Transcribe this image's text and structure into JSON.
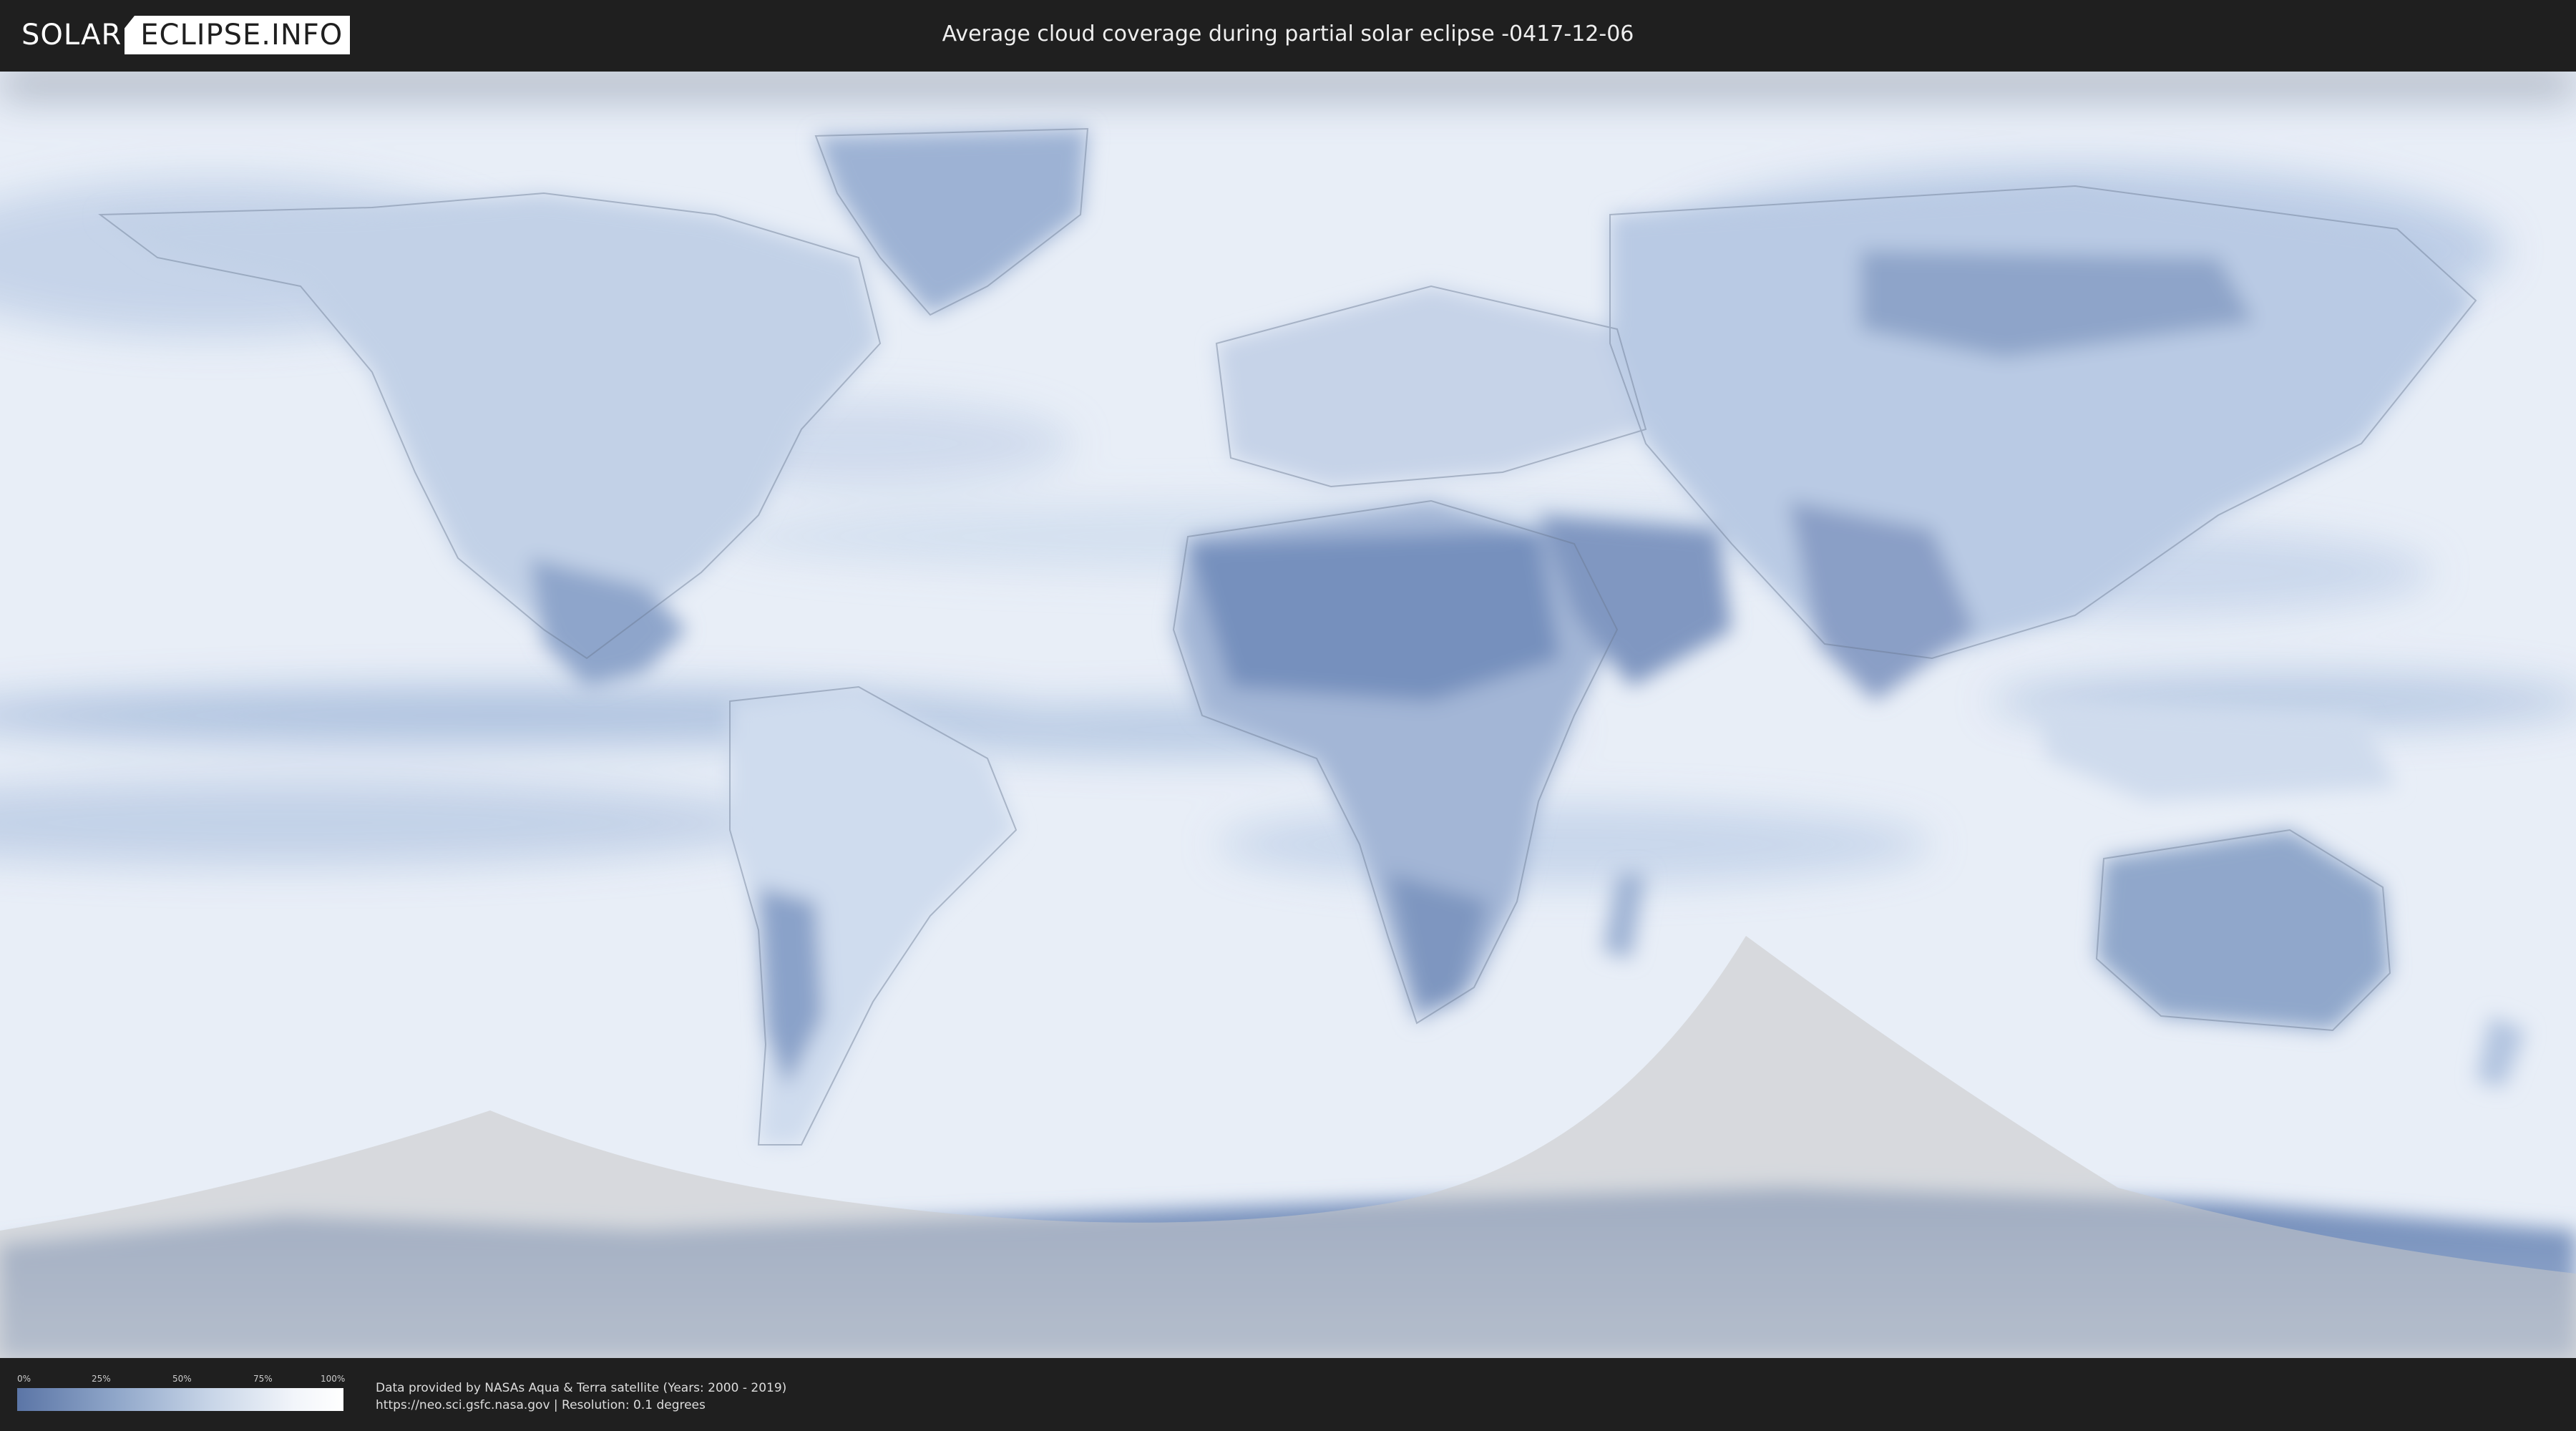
{
  "header": {
    "logo": {
      "part1": "SOLAR",
      "part2": "ECLIPSE.INFO"
    },
    "title": "Average cloud coverage during partial solar eclipse -0417-12-06"
  },
  "map": {
    "description_colors": {
      "ocean_clear": "#ffffff",
      "cloud_low": "#5b75a6",
      "cloud_mid": "#a8bcd9",
      "eclipse_overlay": "#c9c9c9"
    }
  },
  "legend": {
    "ticks": [
      "0%",
      "25%",
      "50%",
      "75%",
      "100%"
    ],
    "gradient_start": "#5b75a6",
    "gradient_end": "#ffffff"
  },
  "footer": {
    "credit_line1": "Data provided by NASAs Aqua & Terra satellite (Years: 2000 - 2019)",
    "credit_line2": "https://neo.sci.gsfc.nasa.gov | Resolution: 0.1 degrees"
  }
}
